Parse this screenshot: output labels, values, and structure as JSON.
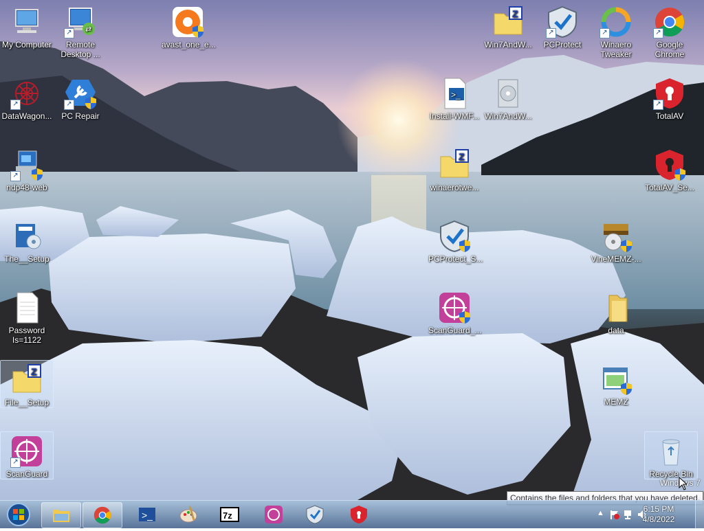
{
  "desktop": {
    "icons": [
      {
        "label": "My Computer"
      },
      {
        "label": "Remote Desktop ..."
      },
      {
        "label": "avast_one_e..."
      },
      {
        "label": "Win7AndW..."
      },
      {
        "label": "PCProtect"
      },
      {
        "label": "Winaero Tweaker"
      },
      {
        "label": "Google Chrome"
      },
      {
        "label": "DataWagon..."
      },
      {
        "label": "PC Repair"
      },
      {
        "label": "Install-WMF..."
      },
      {
        "label": "Win7AndW..."
      },
      {
        "label": "TotalAV"
      },
      {
        "label": "ndp48-web"
      },
      {
        "label": "winaerotwe..."
      },
      {
        "label": "TotalAV_Se..."
      },
      {
        "label": "The__Setup"
      },
      {
        "label": "PCProtect_S..."
      },
      {
        "label": "VineMEMZ-..."
      },
      {
        "label": "Password Is=1122"
      },
      {
        "label": "ScanGuard_..."
      },
      {
        "label": "data"
      },
      {
        "label": "File__Setup"
      },
      {
        "label": "MEMZ"
      },
      {
        "label": "ScanGuard"
      },
      {
        "label": "Recycle Bin"
      }
    ],
    "watermark": "Windows 7",
    "tooltip": "Contains the files and folders that you have deleted."
  },
  "taskbar": {
    "items": [
      {
        "name": "Windows Explorer"
      },
      {
        "name": "Google Chrome"
      },
      {
        "name": "PowerShell"
      },
      {
        "name": "Paint"
      },
      {
        "name": "7-Zip"
      },
      {
        "name": "ScanGuard"
      },
      {
        "name": "PCProtect"
      },
      {
        "name": "TotalAV"
      }
    ],
    "clock": {
      "time": "6:15 PM",
      "date": "4/8/2022"
    }
  }
}
